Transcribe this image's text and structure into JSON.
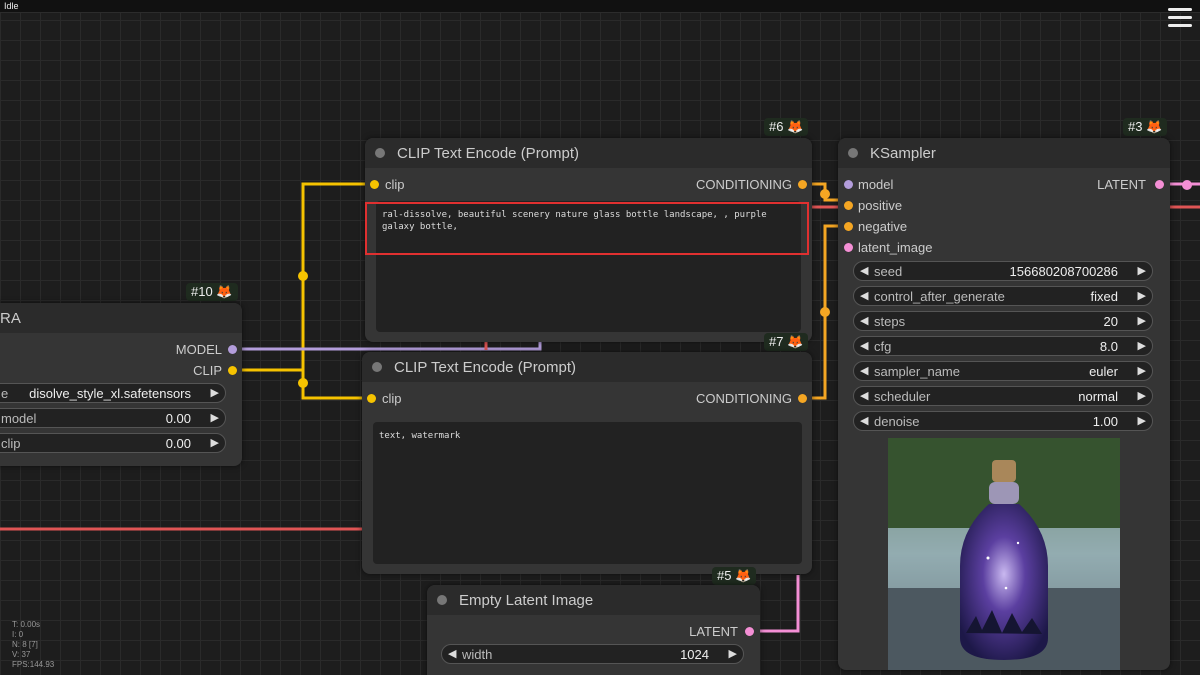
{
  "topbar": {
    "status": "Idle"
  },
  "lora_node": {
    "badge": "#10 🦊",
    "title": "RA",
    "outputs": [
      "MODEL",
      "CLIP"
    ],
    "widgets": [
      {
        "label": "e",
        "value": "disolve_style_xl.safetensors"
      },
      {
        "label": "model",
        "value": "0.00"
      },
      {
        "label": "clip",
        "value": "0.00"
      }
    ]
  },
  "clip_pos_node": {
    "badge": "#6 🦊",
    "title": "CLIP Text Encode (Prompt)",
    "input": "clip",
    "output": "CONDITIONING",
    "text": "ral-dissolve, beautiful scenery nature glass bottle landscape, , purple galaxy bottle,"
  },
  "clip_neg_node": {
    "badge": "#7 🦊",
    "title": "CLIP Text Encode (Prompt)",
    "input": "clip",
    "output": "CONDITIONING",
    "text": "text, watermark"
  },
  "latent_node": {
    "badge": "#5 🦊",
    "title": "Empty Latent Image",
    "output": "LATENT",
    "widgets": [
      {
        "label": "width",
        "value": "1024"
      }
    ]
  },
  "ksampler_node": {
    "badge": "#3 🦊",
    "title": "KSampler",
    "inputs": [
      "model",
      "positive",
      "negative",
      "latent_image"
    ],
    "output": "LATENT",
    "widgets": [
      {
        "label": "seed",
        "value": "156680208700286"
      },
      {
        "label": "control_after_generate",
        "value": "fixed"
      },
      {
        "label": "steps",
        "value": "20"
      },
      {
        "label": "cfg",
        "value": "8.0"
      },
      {
        "label": "sampler_name",
        "value": "euler"
      },
      {
        "label": "scheduler",
        "value": "normal"
      },
      {
        "label": "denoise",
        "value": "1.00"
      }
    ]
  },
  "stats": {
    "t": "T: 0.00s",
    "i": "I: 0",
    "n": "N: 8 [7]",
    "v": "V: 37",
    "fps": "FPS:144.93"
  },
  "colors": {
    "clip_wire": "#f6c300",
    "conditioning_wire": "#f5a623",
    "model_wire": "#b39ddb",
    "latent_wire": "#f48fd5",
    "vae_wire": "#e05555",
    "highlight": "#e03030"
  }
}
